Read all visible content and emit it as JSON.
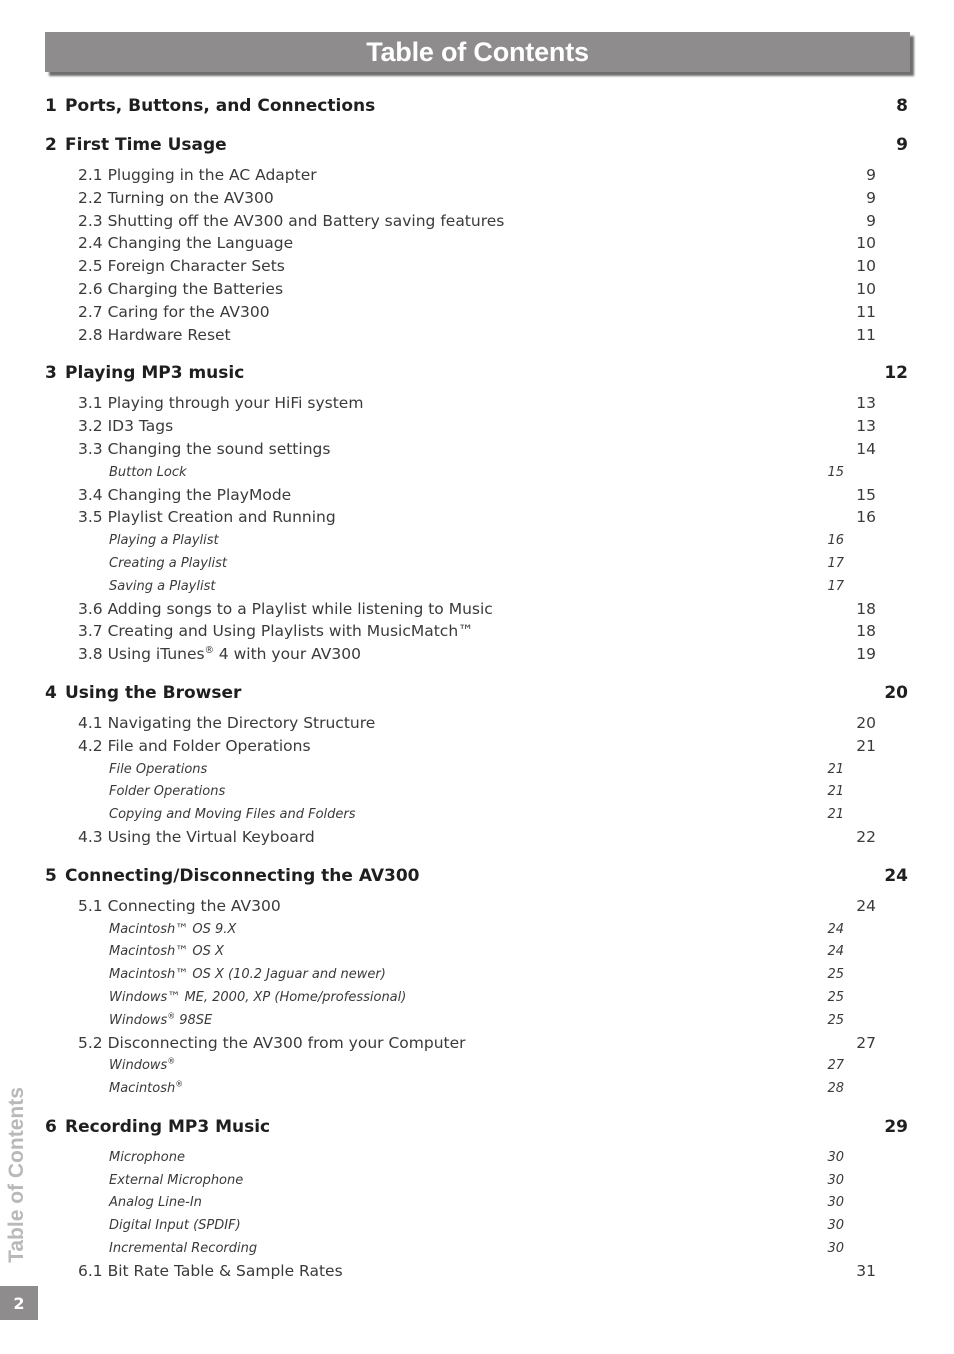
{
  "header": {
    "title": "Table of Contents"
  },
  "sidebar": {
    "tab_label": "Table of Contents",
    "page_number": "2"
  },
  "toc": [
    {
      "type": "chapter",
      "num": "1",
      "label": "Ports, Buttons, and Connections",
      "page": "8"
    },
    {
      "type": "chapter",
      "num": "2",
      "label": "First Time Usage",
      "page": "9"
    },
    {
      "type": "section",
      "label": "2.1 Plugging in the AC Adapter",
      "page": "9"
    },
    {
      "type": "section",
      "label": "2.2 Turning on the AV300",
      "page": "9"
    },
    {
      "type": "section",
      "label": "2.3 Shutting off the AV300 and Battery saving features",
      "page": "9"
    },
    {
      "type": "section",
      "label": "2.4 Changing the Language",
      "page": "10"
    },
    {
      "type": "section",
      "label": "2.5 Foreign Character Sets",
      "page": "10"
    },
    {
      "type": "section",
      "label": "2.6 Charging the Batteries",
      "page": "10"
    },
    {
      "type": "section",
      "label": "2.7 Caring for the AV300",
      "page": "11"
    },
    {
      "type": "section",
      "label": "2.8 Hardware Reset",
      "page": "11"
    },
    {
      "type": "chapter",
      "num": "3",
      "label": "Playing MP3 music",
      "page": "12"
    },
    {
      "type": "section",
      "label": "3.1 Playing through your HiFi system",
      "page": "13"
    },
    {
      "type": "section",
      "label": "3.2 ID3 Tags",
      "page": "13"
    },
    {
      "type": "section",
      "label": "3.3 Changing the sound settings",
      "page": "14"
    },
    {
      "type": "subsection",
      "label": "Button Lock",
      "page": "15"
    },
    {
      "type": "section",
      "label": "3.4 Changing the PlayMode",
      "page": "15"
    },
    {
      "type": "section",
      "label": "3.5 Playlist Creation and Running",
      "page": "16"
    },
    {
      "type": "subsection",
      "label": "Playing a Playlist",
      "page": "16"
    },
    {
      "type": "subsection",
      "label": "Creating a Playlist",
      "page": "17"
    },
    {
      "type": "subsection",
      "label": "Saving a Playlist",
      "page": "17"
    },
    {
      "type": "section",
      "label": "3.6 Adding songs to a Playlist while listening to Music",
      "page": "18"
    },
    {
      "type": "section",
      "label": "3.7 Creating and Using Playlists with MusicMatch™",
      "page": "18"
    },
    {
      "type": "section",
      "label": "3.8 Using iTunes® 4 with your AV300",
      "page": "19"
    },
    {
      "type": "chapter",
      "num": "4",
      "label": "Using the Browser",
      "page": "20"
    },
    {
      "type": "section",
      "label": "4.1 Navigating the Directory Structure",
      "page": "20"
    },
    {
      "type": "section",
      "label": "4.2 File and Folder Operations",
      "page": "21"
    },
    {
      "type": "subsection",
      "label": "File Operations",
      "page": "21"
    },
    {
      "type": "subsection",
      "label": "Folder Operations",
      "page": "21"
    },
    {
      "type": "subsection",
      "label": "Copying and Moving Files and Folders",
      "page": "21"
    },
    {
      "type": "section",
      "label": "4.3 Using the Virtual Keyboard",
      "page": "22"
    },
    {
      "type": "chapter",
      "num": "5",
      "label": "Connecting/Disconnecting the AV300",
      "page": "24"
    },
    {
      "type": "section",
      "label": "5.1 Connecting the AV300",
      "page": "24"
    },
    {
      "type": "subsection",
      "label": "Macintosh™ OS 9.X",
      "page": "24"
    },
    {
      "type": "subsection",
      "label": "Macintosh™ OS X",
      "page": "24"
    },
    {
      "type": "subsection",
      "label": "Macintosh™ OS X (10.2 Jaguar and newer)",
      "page": "25"
    },
    {
      "type": "subsection",
      "label": "Windows™ ME, 2000, XP (Home/professional)",
      "page": "25"
    },
    {
      "type": "subsection",
      "label": "Windows® 98SE",
      "page": "25"
    },
    {
      "type": "section",
      "label": "5.2 Disconnecting the AV300 from your Computer",
      "page": "27"
    },
    {
      "type": "subsection",
      "label": "Windows®",
      "page": "27"
    },
    {
      "type": "subsection",
      "label": "Macintosh®",
      "page": "28"
    },
    {
      "type": "chapter",
      "num": "6",
      "label": "Recording MP3 Music",
      "page": "29"
    },
    {
      "type": "subsection",
      "label": "Microphone",
      "page": "30"
    },
    {
      "type": "subsection",
      "label": "External Microphone",
      "page": "30"
    },
    {
      "type": "subsection",
      "label": "Analog Line-In",
      "page": "30"
    },
    {
      "type": "subsection",
      "label": "Digital Input (SPDIF)",
      "page": "30"
    },
    {
      "type": "subsection",
      "label": "Incremental Recording",
      "page": "30"
    },
    {
      "type": "section",
      "label": "6.1 Bit Rate Table & Sample Rates",
      "page": "31"
    }
  ]
}
